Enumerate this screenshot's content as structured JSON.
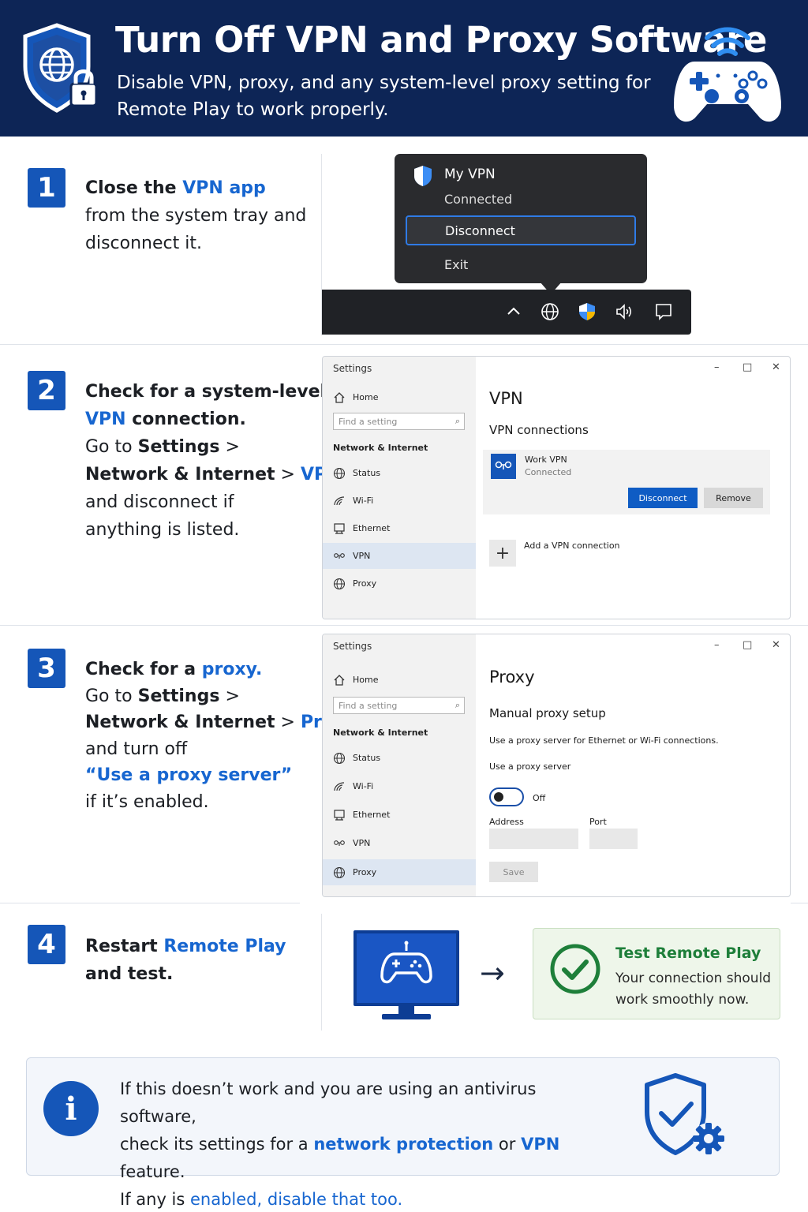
{
  "header": {
    "title": "Turn Off VPN and Proxy Software",
    "subtitle": "Disable VPN, proxy, and any system-level proxy setting for Remote Play to work properly."
  },
  "step1": {
    "number": "1",
    "line1_pre": "Close the ",
    "line1_link": "VPN app",
    "line2": "from the system tray and",
    "line3": "disconnect it.",
    "popup": {
      "title": "My VPN",
      "status": "Connected",
      "disconnect": "Disconnect",
      "exit": "Exit"
    }
  },
  "step2": {
    "number": "2",
    "line1": "Check for a system-level",
    "line2_link": "VPN",
    "line2_rest": " connection.",
    "line3_pre": "Go to ",
    "line3_bold": "Settings",
    "line3_sep": " >",
    "line4_bold": "Network & Internet",
    "line4_sep": " > ",
    "line4_link": "VPN",
    "line4_end": ",",
    "line5": "and disconnect if",
    "line6": "anything is listed.",
    "window": {
      "title": "Settings",
      "home": "Home",
      "search_placeholder": "Find a setting",
      "section": "Network & Internet",
      "nav": [
        "Status",
        "Wi-Fi",
        "Ethernet",
        "VPN",
        "Proxy"
      ],
      "heading": "VPN",
      "subheading": "VPN connections",
      "vpn_name": "Work VPN",
      "vpn_status": "Connected",
      "disconnect_btn": "Disconnect",
      "remove_btn": "Remove",
      "add_label": "Add a VPN connection"
    }
  },
  "step3": {
    "number": "3",
    "line1_pre": "Check for a ",
    "line1_link": "proxy.",
    "line2_pre": "Go to ",
    "line2_bold": "Settings",
    "line2_sep": " >",
    "line3_bold": "Network & Internet",
    "line3_sep": " > ",
    "line3_link": "Proxy,",
    "line4": "and turn off",
    "line5_link": "“Use a proxy server”",
    "line6": "if it’s enabled.",
    "window": {
      "title": "Settings",
      "home": "Home",
      "search_placeholder": "Find a setting",
      "section": "Network & Internet",
      "nav": [
        "Status",
        "Wi-Fi",
        "Ethernet",
        "VPN",
        "Proxy"
      ],
      "heading": "Proxy",
      "subheading": "Manual proxy setup",
      "desc": "Use a proxy server for Ethernet or Wi-Fi connections.",
      "toggle_label": "Use a proxy server",
      "toggle_state": "Off",
      "address_label": "Address",
      "port_label": "Port",
      "save_btn": "Save"
    }
  },
  "step4": {
    "number": "4",
    "line1_pre": "Restart ",
    "line1_link": "Remote Play",
    "line2": "and test.",
    "card_title": "Test Remote Play",
    "card_body": "Your connection should work smoothly now."
  },
  "info": {
    "icon": "i",
    "l1": "If this doesn’t work and you are using an antivirus software,",
    "l2_pre": "check its settings for a ",
    "l2_link1": "network protection",
    "l2_mid": " or ",
    "l2_link2": "VPN",
    "l2_end": " feature.",
    "l3_pre": "If any is ",
    "l3_link": "enabled, disable that too."
  },
  "colors": {
    "header_bg": "#0d2556",
    "accent_blue": "#1766d0",
    "number_badge": "#1556b8",
    "success_green": "#1e7f3a"
  },
  "icons": [
    "shield-globe-lock-icon",
    "gamepad-wifi-icon",
    "chevron-up-icon",
    "globe-icon",
    "shield-icon",
    "speaker-icon",
    "notification-icon",
    "home-icon",
    "search-icon",
    "status-globe-icon",
    "wifi-icon",
    "ethernet-icon",
    "vpn-icon",
    "proxy-globe-icon",
    "plus-icon",
    "monitor-gamepad-icon",
    "arrow-right-icon",
    "check-circle-icon",
    "info-icon",
    "shield-gear-icon"
  ]
}
